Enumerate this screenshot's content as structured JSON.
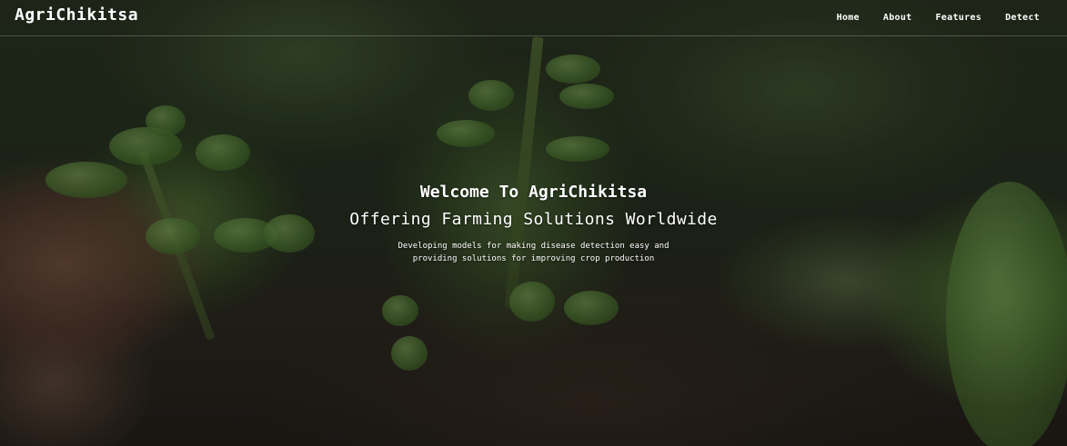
{
  "navbar": {
    "brand": "AgriChikitsa",
    "links": [
      "Home",
      "About",
      "Features",
      "Detect"
    ]
  },
  "hero": {
    "title": "Welcome To AgriChikitsa",
    "subtitle": "Offering Farming Solutions Worldwide",
    "description_line1": "Developing models for making disease detection easy and",
    "description_line2": "providing solutions for improving crop production",
    "background": "blurred-green-plant-photo"
  },
  "colors": {
    "text": "#ffffff",
    "divider": "#ffffff"
  }
}
